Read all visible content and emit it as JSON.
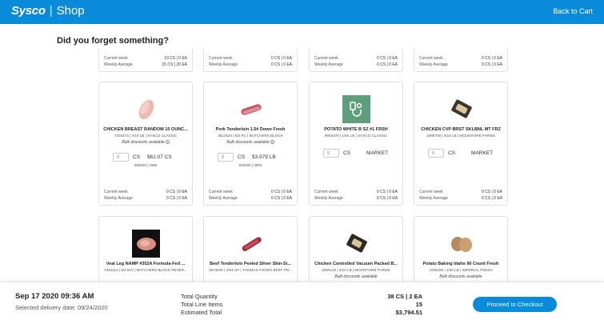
{
  "header": {
    "logo": "Sysco",
    "separator": "|",
    "shop": "Shop",
    "back_label": "Back to Cart"
  },
  "page_title": "Did you forget something?",
  "stat_labels": {
    "current": "Current week",
    "average": "Weekly Average"
  },
  "row0": [
    {
      "current": "10 CS | 0 EA",
      "average": "15 CS | 20 EA"
    },
    {
      "current": "0 CS | 0 EA",
      "average": "0 CS | 0 EA"
    },
    {
      "current": "0 CS | 0 EA",
      "average": "0 CS | 0 EA"
    },
    {
      "current": "0 CS | 0 EA",
      "average": "0 CS | 0 EA"
    }
  ],
  "row1": [
    {
      "name": "CHICKEN BREAST RANDOM 10 OUNC...",
      "meta": "7203474 | 4/10 LB | SYSCO CLASSIC",
      "bulk": "Bulk discounts available",
      "qty_placeholder": "0",
      "unit": "CS",
      "price": "$61.07 CS",
      "code": "598400 | 1985",
      "current": "0 CS | 0 EA",
      "average": "0 CS | 0 EA",
      "image_icon": "chicken-breast-image"
    },
    {
      "name": "Pork Tenderloin 1.5# Down Fresh",
      "meta": "3812534 | 6/2 PC | BUTCHERS BLOCK",
      "bulk": "Bulk discounts available",
      "qty_placeholder": "0",
      "unit": "CS",
      "price": "$3.979 LB",
      "code": "932000 | 3993",
      "current": "0 CS | 0 EA",
      "average": "0 CS | 0 EA",
      "image_icon": "pork-tenderloin-image"
    },
    {
      "name": "POTATO WHITE B SZ #1 FRSH",
      "meta": "9903378 | 1/50 LB | SYSCO CLASSIC",
      "qty_placeholder": "0",
      "unit": "CS",
      "market": "MARKET",
      "current": "0 CS | 0 EA",
      "average": "0 CS | 0 EA",
      "image_icon": "product-placeholder-icon"
    },
    {
      "name": "CHICKEN CVP BRST SKLBNL MT FRZ",
      "meta": "2096739 | 4/10 LB | MOUNTAIRE FARMS",
      "qty_placeholder": "0",
      "unit": "CS",
      "market": "MARKET",
      "current": "0 CS | 0 EA",
      "average": "0 CS | 0 EA",
      "image_icon": "chicken-package-image"
    }
  ],
  "row2": [
    {
      "name": "Veal Leg NAMP #352A Formula-Fed ...",
      "meta": "7461114 | 6/2.5AV | BUTCHERS BLOCK RESER..."
    },
    {
      "name": "Beef Tenderloin Peeled Silver Skin-Si...",
      "meta": "3873205 | 2/64 UP | THOMAS-FOODS BEEF PR..."
    },
    {
      "name": "Chicken Controlled Vacuum Packed B...",
      "meta": "2080143 | 4/10 LB | MOUNTAIRE FARMS",
      "bulk": "Bulk discounts available"
    },
    {
      "name": "Potato Baking Idaho 90 Count Fresh",
      "meta": "1008465 | 1/50 LB | IMPERIAL FRESH",
      "bulk": "Bulk discounts available"
    }
  ],
  "footer": {
    "date": "Sep 17 2020 09:36 AM",
    "delivery": "Selected delivery date: 09/24/2020",
    "totals_labels": [
      "Total Quantity",
      "Total Line Items",
      "Estimated Total"
    ],
    "totals_values": [
      "38 CS | 2 EA",
      "15",
      "$3,794.51"
    ],
    "checkout_label": "Proceed to Checkout"
  },
  "colors": {
    "brand_blue": "#0a8bd9",
    "placeholder_green": "#5e9e7c"
  }
}
